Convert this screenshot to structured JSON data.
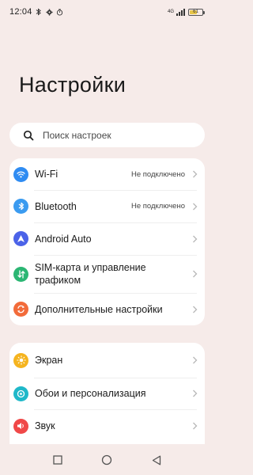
{
  "status_bar": {
    "time": "12:04",
    "network": "4G",
    "battery_percent": "61",
    "battery_level": 0.61
  },
  "page": {
    "title": "Настройки"
  },
  "search": {
    "placeholder": "Поиск настроек",
    "icon": "search-icon"
  },
  "groups": [
    {
      "items": [
        {
          "label": "Wi-Fi",
          "value": "Не подключено",
          "icon": "wifi-icon",
          "color": "#2f8cf2"
        },
        {
          "label": "Bluetooth",
          "value": "Не подключено",
          "icon": "bluetooth-icon",
          "color": "#3a9bf0"
        },
        {
          "label": "Android Auto",
          "value": "",
          "icon": "android-auto-icon",
          "color": "#4b63e8"
        },
        {
          "label": "SIM-карта и управление трафиком",
          "value": "",
          "icon": "sim-traffic-icon",
          "color": "#2bb673"
        },
        {
          "label": "Дополнительные настройки",
          "value": "",
          "icon": "more-settings-icon",
          "color": "#f26b3a"
        }
      ]
    },
    {
      "items": [
        {
          "label": "Экран",
          "value": "",
          "icon": "display-icon",
          "color": "#f5b41f"
        },
        {
          "label": "Обои и персонализация",
          "value": "",
          "icon": "wallpaper-icon",
          "color": "#1fb8c9"
        },
        {
          "label": "Звук",
          "value": "",
          "icon": "sound-icon",
          "color": "#f04848"
        }
      ]
    }
  ],
  "nav_bar": {
    "recents": "recents-icon",
    "home": "home-icon",
    "back": "back-icon"
  }
}
